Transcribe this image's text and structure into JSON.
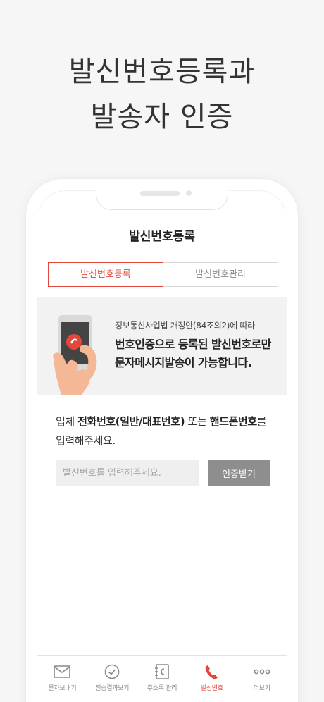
{
  "hero": {
    "line1": "발신번호등록과",
    "line2": "발송자 인증"
  },
  "header": {
    "title": "발신번호등록"
  },
  "tabs": [
    {
      "label": "발신번호등록",
      "active": true
    },
    {
      "label": "발신번호관리",
      "active": false
    }
  ],
  "banner": {
    "sub": "정보통신사업법 개정안(84조의2)에 따라",
    "line1": "번호인증으로 등록된 발신번호로만",
    "line2": "문자메시지발송이 가능합니다.",
    "illustration_icon": "hand-holding-phone-icon"
  },
  "guide": {
    "prefix": "업체 ",
    "bold1": "전화번호(일반/대표번호)",
    "middle": " 또는 ",
    "bold2": "핸드폰번호",
    "suffix": "를 입력해주세요."
  },
  "form": {
    "placeholder": "발신번호를 입력해주세요.",
    "value": "",
    "button_label": "인증받기"
  },
  "tabbar": [
    {
      "label": "문자보내기",
      "icon": "envelope-icon",
      "active": false
    },
    {
      "label": "전송결과보기",
      "icon": "check-circle-icon",
      "active": false
    },
    {
      "label": "주소록 관리",
      "icon": "address-book-icon",
      "active": false
    },
    {
      "label": "발신번호",
      "icon": "phone-icon",
      "active": true
    },
    {
      "label": "더보기",
      "icon": "more-dots-icon",
      "active": false
    }
  ],
  "colors": {
    "accent": "#e3463a",
    "button_gray": "#8e8e8e",
    "banner_bg": "#f2f2f2",
    "page_bg": "#f6f6f6"
  }
}
